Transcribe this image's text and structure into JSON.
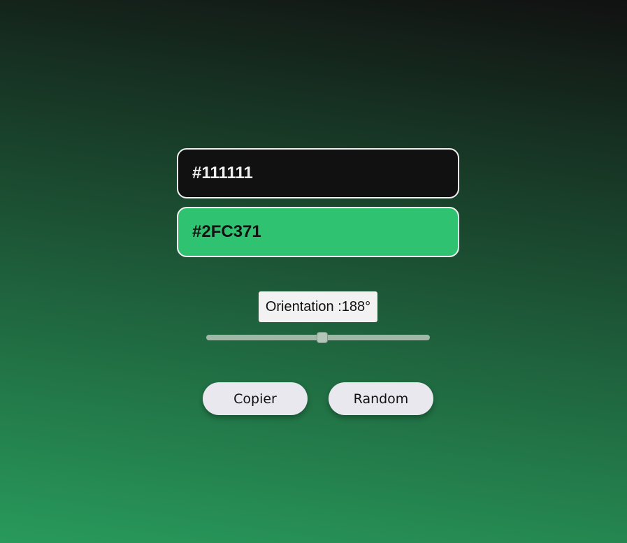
{
  "colors": {
    "first": "#111111",
    "second": "#2FC371"
  },
  "orientation": {
    "label": "Orientation :188°",
    "angle_deg": 188,
    "slider_fraction": 0.52
  },
  "buttons": {
    "copy_label": "Copier",
    "random_label": "Random"
  }
}
